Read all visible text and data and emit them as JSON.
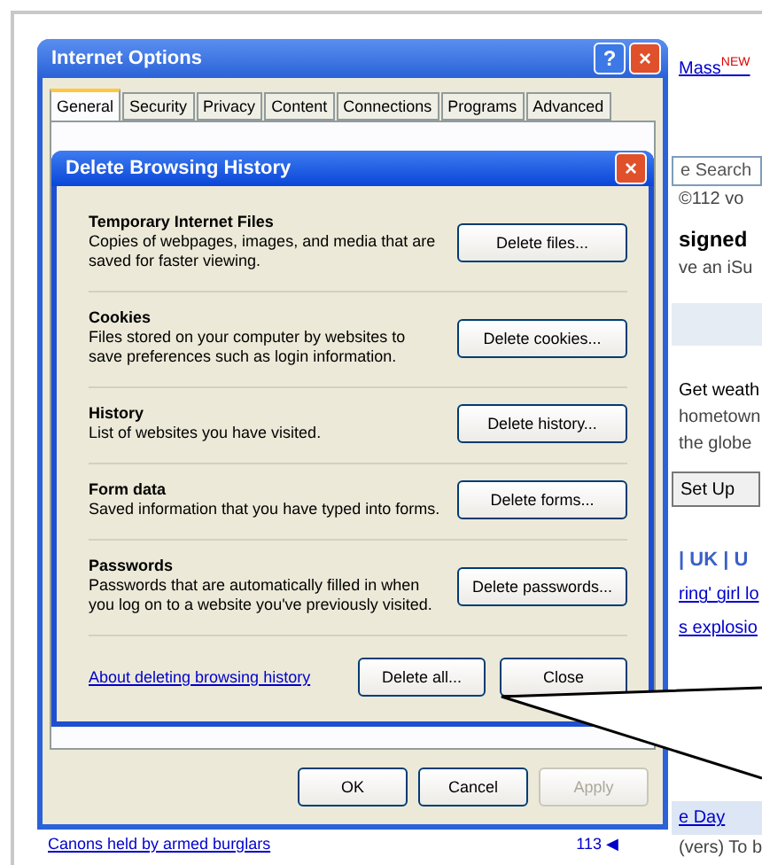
{
  "browser_page": {
    "fragments": [
      {
        "kind": "link",
        "text": "Mass",
        "badge": "NEW"
      },
      {
        "kind": "field",
        "text": "e Search"
      },
      {
        "kind": "text",
        "text": "©112 vo"
      },
      {
        "kind": "heading",
        "text": "signed"
      },
      {
        "kind": "text",
        "text": "ve an iSu"
      },
      {
        "kind": "band",
        "text": "Get weath"
      },
      {
        "kind": "text",
        "text": "hometown"
      },
      {
        "kind": "text",
        "text": "the globe"
      },
      {
        "kind": "button",
        "text": "Set Up"
      },
      {
        "kind": "heading-link",
        "text": "| UK | U"
      },
      {
        "kind": "link",
        "text": "ring' girl lo"
      },
      {
        "kind": "link",
        "text": "s explosio"
      },
      {
        "kind": "section",
        "text": "e Day"
      },
      {
        "kind": "text",
        "text": "(vers) To b"
      }
    ],
    "bottom_link": "Canons held by armed burglars",
    "count": "113",
    "share_glyph": "◀"
  },
  "options_window": {
    "title": "Internet Options",
    "title_buttons": [
      "?",
      "×"
    ],
    "tabs": [
      {
        "label": "General",
        "selected": true
      },
      {
        "label": "Security",
        "selected": false
      },
      {
        "label": "Privacy",
        "selected": false
      },
      {
        "label": "Content",
        "selected": false
      },
      {
        "label": "Connections",
        "selected": false
      },
      {
        "label": "Programs",
        "selected": false
      },
      {
        "label": "Advanced",
        "selected": false
      }
    ],
    "buttons": [
      {
        "label": "OK",
        "disabled": false
      },
      {
        "label": "Cancel",
        "disabled": false
      },
      {
        "label": "Apply",
        "disabled": true
      }
    ]
  },
  "delete_dialog": {
    "title": "Delete Browsing History",
    "close": "×",
    "sections": [
      {
        "heading": "Temporary Internet Files",
        "description": "Copies of webpages, images, and media that are saved for faster viewing.",
        "button": "Delete files..."
      },
      {
        "heading": "Cookies",
        "description": "Files stored on your computer by websites to save preferences such as login information.",
        "button": "Delete cookies..."
      },
      {
        "heading": "History",
        "description": "List of websites you have visited.",
        "button": "Delete history..."
      },
      {
        "heading": "Form data",
        "description": "Saved information that you have typed into forms.",
        "button": "Delete forms..."
      },
      {
        "heading": "Passwords",
        "description": "Passwords that are automatically filled in when you log on to a website you've previously visited.",
        "button": "Delete passwords..."
      }
    ],
    "link": "About deleting browsing history",
    "buttons": [
      "Delete all...",
      "Close"
    ]
  }
}
